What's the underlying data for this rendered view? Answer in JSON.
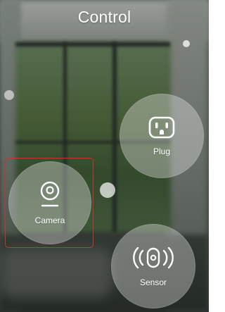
{
  "header": {
    "title": "Control"
  },
  "devices": [
    {
      "label": "Plug",
      "icon": "plug-icon"
    },
    {
      "label": "Camera",
      "icon": "camera-icon"
    },
    {
      "label": "Sensor",
      "icon": "sensor-icon"
    }
  ],
  "colors": {
    "title_text": "#ffffff",
    "selection_border": "#c0392b",
    "device_circle": "rgba(230,232,228,0.38)"
  },
  "selected_device": "Camera"
}
